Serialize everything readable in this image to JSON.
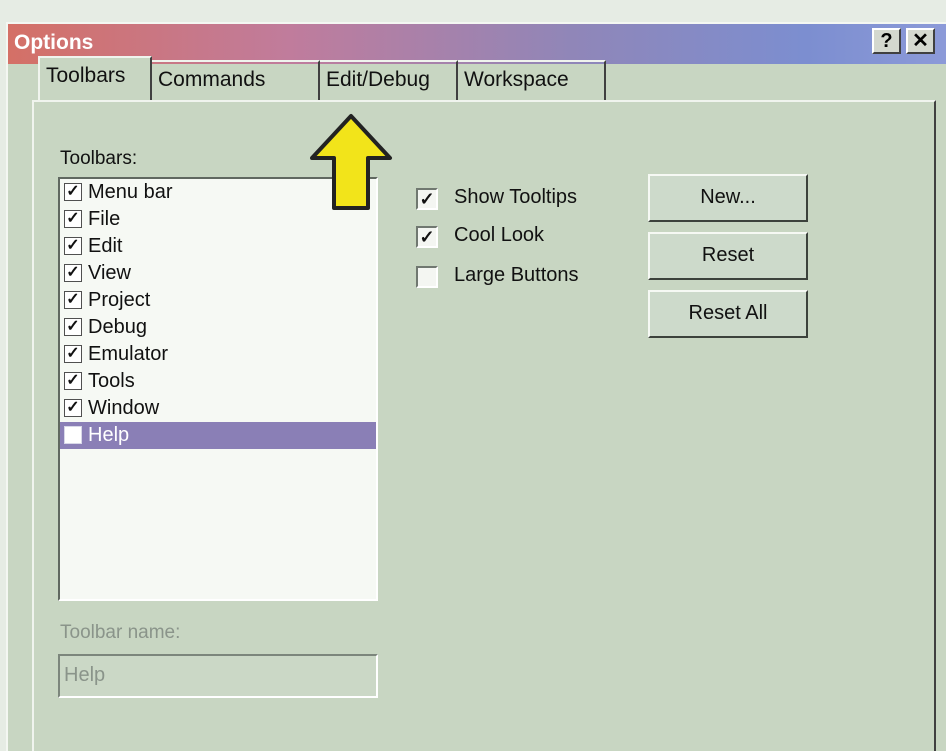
{
  "window": {
    "title": "Options",
    "help_glyph": "?",
    "close_glyph": "✕"
  },
  "tabs": [
    "Toolbars",
    "Commands",
    "Edit/Debug",
    "Workspace"
  ],
  "toolbars_label": "Toolbars:",
  "toolbars": [
    {
      "label": "Menu bar",
      "checked": true
    },
    {
      "label": "File",
      "checked": true
    },
    {
      "label": "Edit",
      "checked": true
    },
    {
      "label": "View",
      "checked": true
    },
    {
      "label": "Project",
      "checked": true
    },
    {
      "label": "Debug",
      "checked": true
    },
    {
      "label": "Emulator",
      "checked": true
    },
    {
      "label": "Tools",
      "checked": true
    },
    {
      "label": "Window",
      "checked": true
    },
    {
      "label": "Help",
      "checked": false,
      "selected": true
    }
  ],
  "options": [
    {
      "label": "Show Tooltips",
      "checked": true
    },
    {
      "label": "Cool Look",
      "checked": true
    },
    {
      "label": "Large Buttons",
      "checked": false
    }
  ],
  "buttons": {
    "new": "New...",
    "reset": "Reset",
    "reset_all": "Reset All"
  },
  "toolbar_name": {
    "label": "Toolbar name:",
    "value": "Help"
  },
  "colors": {
    "selection": "#8a7fb6",
    "arrow": "#f2e41a",
    "title_start": "#d47066",
    "title_end": "#8c9ad8"
  }
}
